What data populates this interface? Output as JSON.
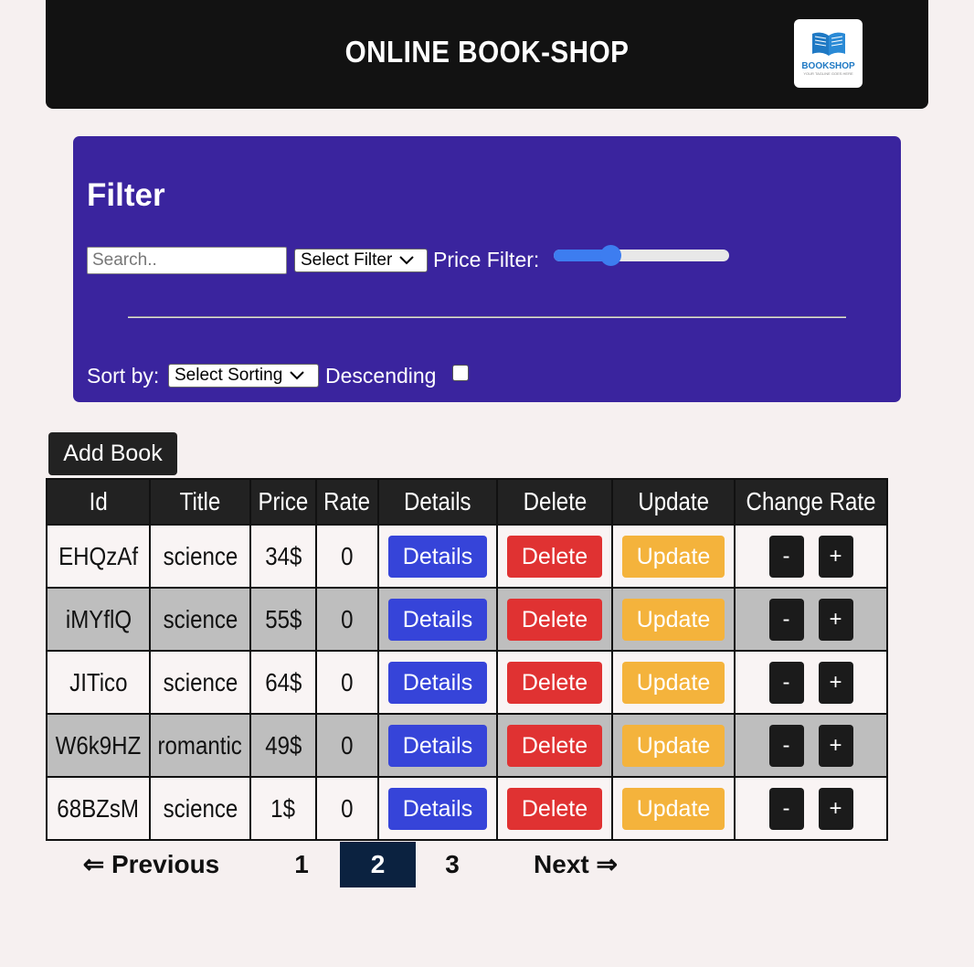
{
  "header": {
    "title": "ONLINE BOOK-SHOP",
    "logo_text": "BOOKSHOP",
    "logo_sub": "YOUR TAGLINE GOES HERE"
  },
  "filter": {
    "title": "Filter",
    "search_placeholder": "Search..",
    "select_filter": "Select Filter",
    "price_label": "Price Filter:",
    "price_slider_fraction": 0.32,
    "sort_label": "Sort by:",
    "select_sorting": "Select Sorting",
    "descending_label": "Descending",
    "descending_checked": false
  },
  "add_book": "Add Book",
  "table": {
    "headers": [
      "Id",
      "Title",
      "Price",
      "Rate",
      "Details",
      "Delete",
      "Update",
      "Change Rate"
    ],
    "rows": [
      {
        "id": "EHQzAf",
        "title": "science",
        "price": "34$",
        "rate": "0"
      },
      {
        "id": "iMYflQ",
        "title": "science",
        "price": "55$",
        "rate": "0"
      },
      {
        "id": "JITico",
        "title": "science",
        "price": "64$",
        "rate": "0"
      },
      {
        "id": "W6k9HZ",
        "title": "romantic",
        "price": "49$",
        "rate": "0"
      },
      {
        "id": "68BZsM",
        "title": "science",
        "price": "1$",
        "rate": "0"
      }
    ],
    "details_label": "Details",
    "delete_label": "Delete",
    "update_label": "Update",
    "minus_label": "-",
    "plus_label": "+"
  },
  "pagination": {
    "previous": "⇐ Previous",
    "pages": [
      "1",
      "2",
      "3"
    ],
    "current": "2",
    "next": "Next ⇒"
  },
  "colors": {
    "filter_bg": "#3a249e",
    "details": "#3644d9",
    "delete": "#e03232",
    "update": "#f4b33c",
    "active_page": "#0b2240"
  }
}
